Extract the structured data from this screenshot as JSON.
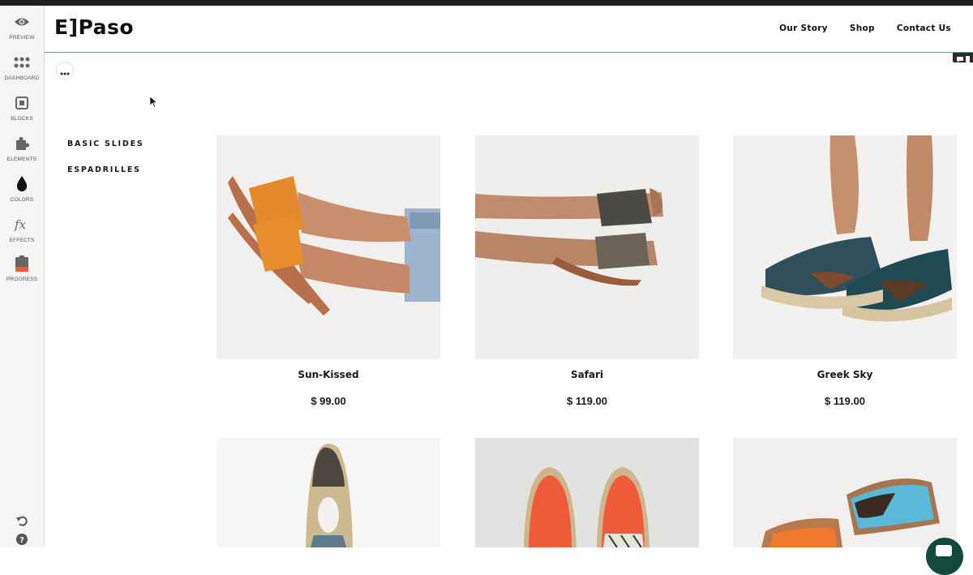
{
  "editor": {
    "sidebar": [
      {
        "label": "PREVIEW",
        "icon": "eye-icon"
      },
      {
        "label": "DASHBOARD",
        "icon": "grid-dots-icon"
      },
      {
        "label": "BLOCKS",
        "icon": "block-square-icon"
      },
      {
        "label": "ELEMENTS",
        "icon": "puzzle-piece-icon"
      },
      {
        "label": "COLORS",
        "icon": "droplet-icon"
      },
      {
        "label": "EFFECTS",
        "icon": "fx-icon"
      },
      {
        "label": "PROGRESS",
        "icon": "progress-battery-icon"
      }
    ],
    "bottom_icons": [
      "undo-icon",
      "help-icon"
    ],
    "accent": "#f05a3c"
  },
  "site": {
    "logo": "E]Paso",
    "nav": [
      "Our Story",
      "Shop",
      "Contact Us"
    ],
    "categories": [
      "BASIC SLIDES",
      "ESPADRILLES"
    ],
    "products": [
      {
        "name": "Sun-Kissed",
        "price": "$ 99.00"
      },
      {
        "name": "Safari",
        "price": "$ 119.00"
      },
      {
        "name": "Greek Sky",
        "price": "$ 119.00"
      }
    ],
    "chat_color": "#12493d"
  }
}
